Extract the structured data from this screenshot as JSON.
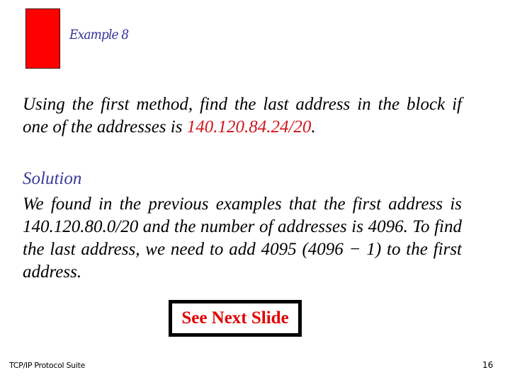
{
  "slide": {
    "title": "Example 8",
    "question": {
      "text_before": "Using the first method, find the last address in the block if one of the addresses is ",
      "highlight": "140.120.84.24/20",
      "text_after": "."
    },
    "solution_label": "Solution",
    "solution_text": "We found in the previous examples that the first address is 140.120.80.0/20 and the number of addresses is 4096. To find the last address, we need to add 4095 (4096 − 1) to the first address.",
    "next_button": "See Next Slide",
    "colors": {
      "accent_red": "#d0161d",
      "title_blue": "#33339a",
      "block_red": "#ff0000"
    }
  },
  "footer": {
    "left": "TCP/IP Protocol Suite",
    "page_number": "16"
  }
}
